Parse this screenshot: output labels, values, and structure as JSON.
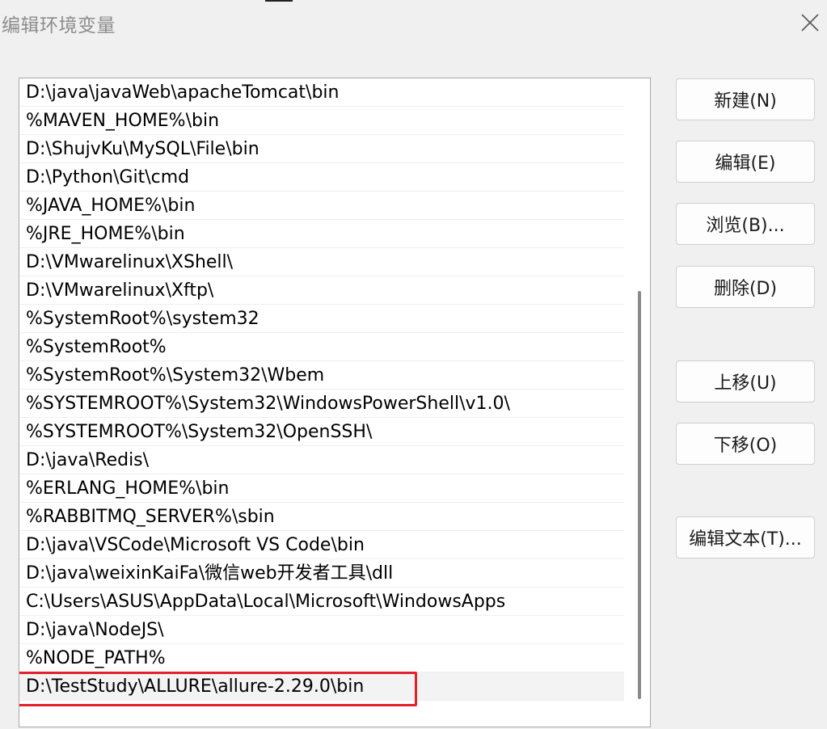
{
  "window": {
    "title": "编辑环境变量"
  },
  "paths": [
    "D:\\java\\javaWeb\\apacheTomcat\\bin",
    "%MAVEN_HOME%\\bin",
    "D:\\ShujvKu\\MySQL\\File\\bin",
    "D:\\Python\\Git\\cmd",
    "%JAVA_HOME%\\bin",
    "%JRE_HOME%\\bin",
    "D:\\VMwarelinux\\XShell\\",
    "D:\\VMwarelinux\\Xftp\\",
    "%SystemRoot%\\system32",
    "%SystemRoot%",
    "%SystemRoot%\\System32\\Wbem",
    "%SYSTEMROOT%\\System32\\WindowsPowerShell\\v1.0\\",
    "%SYSTEMROOT%\\System32\\OpenSSH\\",
    "D:\\java\\Redis\\",
    "%ERLANG_HOME%\\bin",
    "%RABBITMQ_SERVER%\\sbin",
    "D:\\java\\VSCode\\Microsoft VS Code\\bin",
    "D:\\java\\weixinKaiFa\\微信web开发者工具\\dll",
    "C:\\Users\\ASUS\\AppData\\Local\\Microsoft\\WindowsApps",
    "D:\\java\\NodeJS\\",
    "%NODE_PATH%",
    "D:\\TestStudy\\ALLURE\\allure-2.29.0\\bin"
  ],
  "selected_index": 21,
  "buttons": {
    "new": "新建(N)",
    "edit": "编辑(E)",
    "browse": "浏览(B)...",
    "delete": "删除(D)",
    "move_up": "上移(U)",
    "move_down": "下移(O)",
    "edit_text": "编辑文本(T)..."
  },
  "colors": {
    "highlight": "#e5202b"
  },
  "icons": {
    "close": "close-icon"
  }
}
